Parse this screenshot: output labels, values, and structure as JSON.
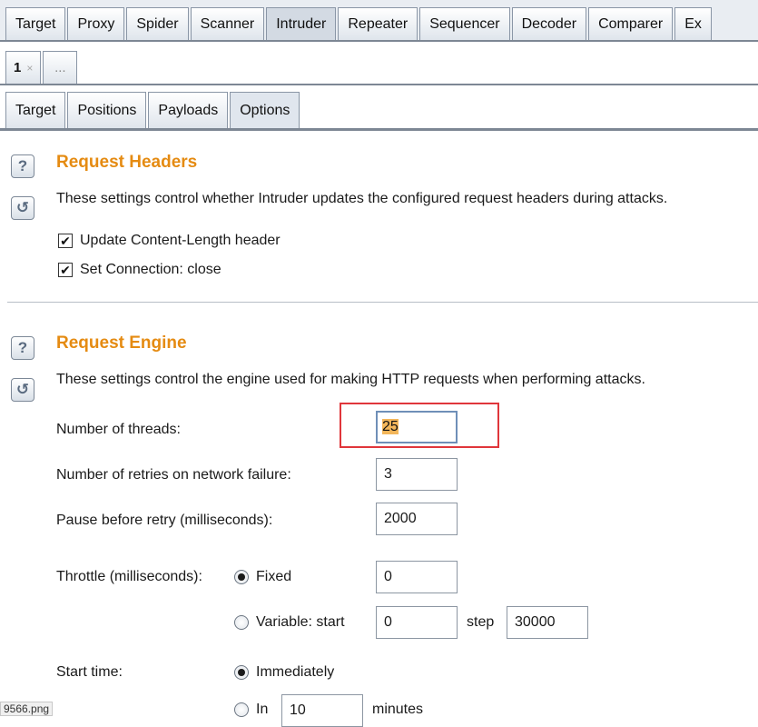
{
  "main_tabs": [
    "Target",
    "Proxy",
    "Spider",
    "Scanner",
    "Intruder",
    "Repeater",
    "Sequencer",
    "Decoder",
    "Comparer",
    "Ex"
  ],
  "main_active": "Intruder",
  "attack_tabs": {
    "first_label": "1",
    "close_glyph": "×",
    "more_label": "..."
  },
  "sub_tabs": [
    "Target",
    "Positions",
    "Payloads",
    "Options"
  ],
  "sub_active": "Options",
  "request_headers": {
    "help_glyph": "?",
    "reset_glyph": "↺",
    "title": "Request Headers",
    "description": "These settings control whether Intruder updates the configured request headers during attacks.",
    "options": [
      {
        "label": "Update Content-Length header",
        "checked": true
      },
      {
        "label": "Set Connection: close",
        "checked": true
      }
    ]
  },
  "request_engine": {
    "help_glyph": "?",
    "reset_glyph": "↺",
    "title": "Request Engine",
    "description": "These settings control the engine used for making HTTP requests when performing attacks.",
    "threads_label": "Number of threads:",
    "threads_value": "25",
    "retries_label": "Number of retries on network failure:",
    "retries_value": "3",
    "pause_label": "Pause before retry (milliseconds):",
    "pause_value": "2000",
    "throttle_label": "Throttle (milliseconds):",
    "throttle_fixed_label": "Fixed",
    "throttle_fixed_value": "0",
    "throttle_variable_label": "Variable:  start",
    "throttle_variable_start": "0",
    "throttle_step_label": "step",
    "throttle_step_value": "30000",
    "throttle_selected": "Fixed",
    "start_time_label": "Start time:",
    "start_immediately_label": "Immediately",
    "start_in_label": "In",
    "start_in_value": "10",
    "start_in_unit": "minutes",
    "start_selected": "Immediately"
  },
  "filename_fragment": "9566.png",
  "colors": {
    "section_title": "#e58b12",
    "highlight_border": "#e0363b",
    "selection": "#f3b65a"
  },
  "icons": {
    "checkbox_checked": "✔"
  }
}
